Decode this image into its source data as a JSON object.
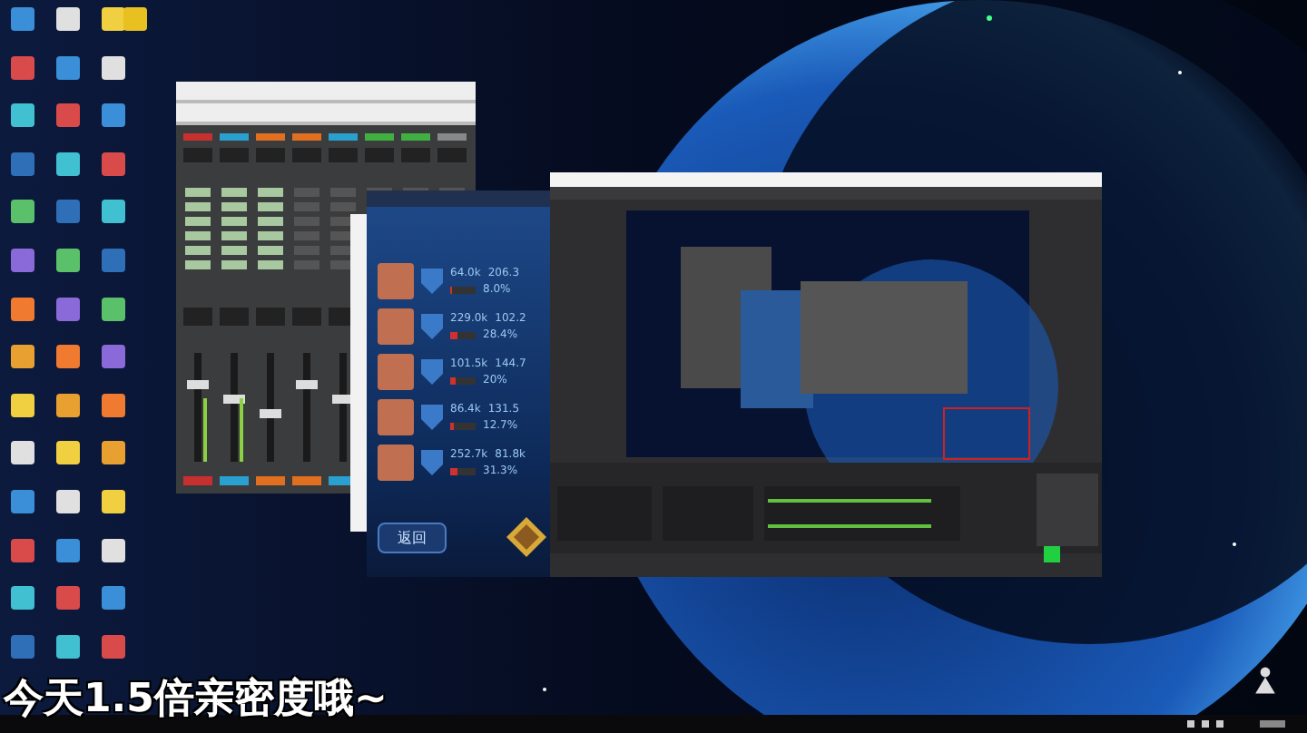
{
  "caption": "今天1.5倍亲密度哦~",
  "game_window": {
    "rows": [
      {
        "value_1": "64.0k",
        "value_2": "206.3",
        "percent": "8.0%",
        "level": 0.08
      },
      {
        "value_1": "229.0k",
        "value_2": "102.2",
        "percent": "28.4%",
        "level": 0.28
      },
      {
        "value_1": "101.5k",
        "value_2": "144.7",
        "percent": "20%",
        "level": 0.2
      },
      {
        "value_1": "86.4k",
        "value_2": "131.5",
        "percent": "12.7%",
        "level": 0.13
      },
      {
        "value_1": "252.7k",
        "value_2": "81.8k",
        "percent": "31.3%",
        "level": 0.31
      }
    ],
    "back_button": "返回"
  }
}
